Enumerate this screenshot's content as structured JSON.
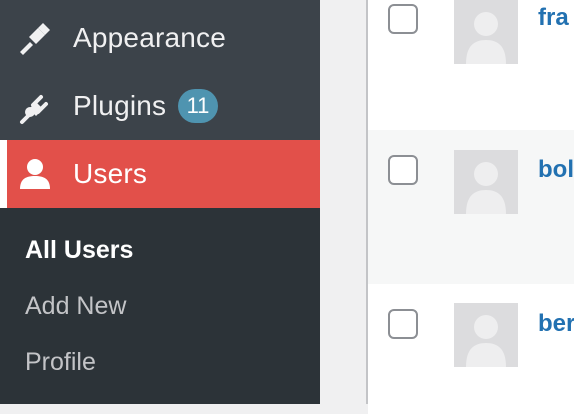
{
  "sidebar": {
    "items": [
      {
        "label": "Appearance",
        "icon": "paintbrush-icon"
      },
      {
        "label": "Plugins",
        "icon": "plug-icon",
        "badge": "11"
      },
      {
        "label": "Users",
        "icon": "user-icon",
        "active": true
      }
    ],
    "submenu": [
      {
        "label": "All Users",
        "current": true
      },
      {
        "label": "Add New"
      },
      {
        "label": "Profile"
      }
    ]
  },
  "users_table": {
    "rows": [
      {
        "username": "fra"
      },
      {
        "username": "bol"
      },
      {
        "username": "ber"
      }
    ]
  },
  "colors": {
    "sidebar_bg": "#3c434a",
    "submenu_bg": "#2c3338",
    "active_bg": "#e2504a",
    "badge_bg": "#4f94b0",
    "link": "#2271b1"
  }
}
